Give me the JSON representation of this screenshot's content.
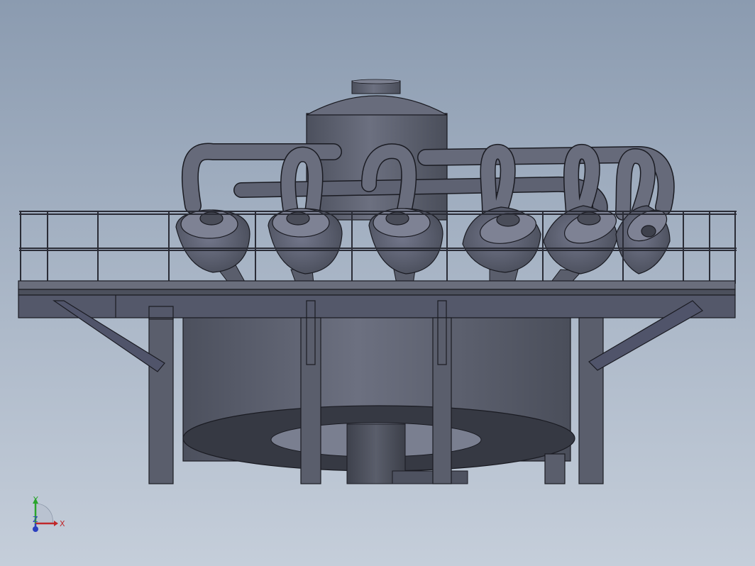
{
  "viewport": {
    "background_top": "#8b9bb0",
    "background_bottom": "#c5ceda",
    "model_color": "#5e6270",
    "edge_color": "#1a1b22"
  },
  "triad": {
    "x_label": "X",
    "y_label": "Y",
    "z_label": "Z",
    "x_color": "#c0282b",
    "y_color": "#2aa52c",
    "z_color": "#2b3fbf"
  }
}
